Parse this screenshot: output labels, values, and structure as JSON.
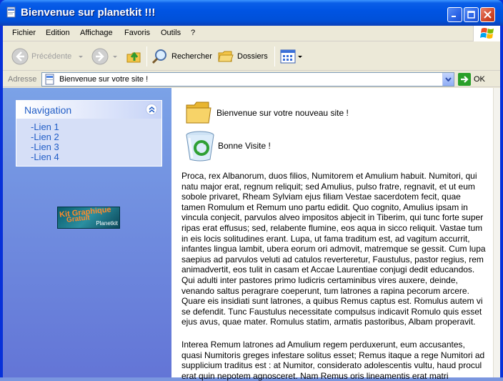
{
  "window": {
    "title": "Bienvenue sur planetkit !!!"
  },
  "menu": [
    "Fichier",
    "Edition",
    "Affichage",
    "Favoris",
    "Outils",
    "?"
  ],
  "toolbar": {
    "back_label": "Précédente",
    "search_label": "Rechercher",
    "folders_label": "Dossiers"
  },
  "address": {
    "label": "Adresse",
    "value": "Bienvenue sur votre site !",
    "go_label": "OK"
  },
  "sidebar": {
    "nav_title": "Navigation",
    "links": [
      "-Lien 1",
      "-Lien 2",
      "-Lien 3",
      "-Lien 4"
    ],
    "banner": {
      "line1": "Kit Graphique",
      "line2": "Gratuit",
      "brand": "Planetkit"
    }
  },
  "main": {
    "folder_label": "Bienvenue sur votre nouveau site !",
    "recycle_label": "Bonne Visite !",
    "paragraph1": "Proca, rex Albanorum, duos filios, Numitorem et Amulium habuit. Numitori, qui natu major erat, regnum reliquit; sed Amulius, pulso fratre, regnavit, et ut eum sobole privaret, Rheam Sylviam ejus filiam Vestae sacerdotem fecit, quae tamen Romulum et Remum uno partu edidit. Quo cognito, Amulius ipsam in vincula conjecit, parvulos alveo impositos abjecit in Tiberim, qui tunc forte super ripas erat effusus; sed, relabente flumine, eos aqua in sicco reliquit. Vastae tum in eis locis solitudines erant. Lupa, ut fama traditum est, ad vagitum accurrit, infantes lingua lambit, ubera eorum ori admovit, matremque se gessit. Cum lupa saepius ad parvulos veluti ad catulos reverteretur, Faustulus, pastor regius, rem animadvertit, eos tulit in casam et Accae Laurentiae conjugi dedit educandos. Qui adulti inter pastores primo ludicris certaminibus vires auxere, deinde, venando saltus peragrare coeperunt, tum latrones a rapina pecorum arcere. Quare eis insidiati sunt latrones, a quibus Remus captus est. Romulus autem vi se defendit. Tunc Faustulus necessitate compulsus indicavit Romulo quis esset ejus avus, quae mater. Romulus statim, armatis pastoribus, Albam properavit.",
    "paragraph2": "Interea Remum latrones ad Amulium regem perduxerunt, eum accusantes, quasi Numitoris greges infestare solitus esset; Remus itaque a rege Numitori ad supplicium traditus est : at Numitor, considerato adolescentis vultu, haud procul erat quin nepotem agnosceret. Nam Remus oris lineamentis erat matri"
  }
}
